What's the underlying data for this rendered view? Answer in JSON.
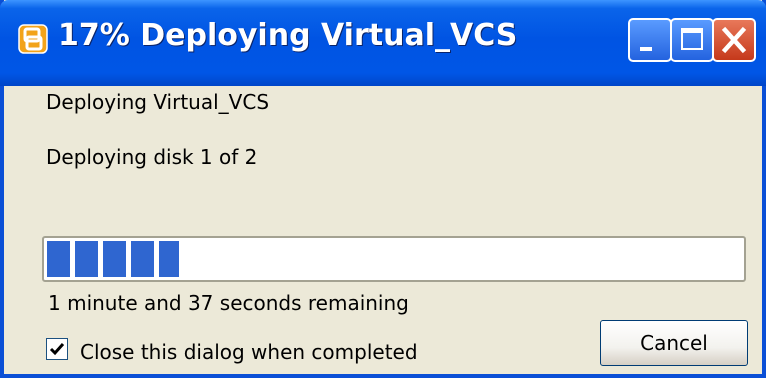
{
  "window": {
    "title": "17% Deploying Virtual_VCS",
    "icon": "vsphere-app-icon",
    "title_controls": [
      "minimize-icon",
      "maximize-icon",
      "close-icon"
    ]
  },
  "dialog": {
    "message_primary": "Deploying Virtual_VCS",
    "message_secondary": "Deploying disk 1 of 2",
    "progress_fraction": 0.19,
    "time_remaining": "1 minute and 37 seconds remaining",
    "close_when_completed": {
      "label": "Close this dialog when completed",
      "checked": true
    },
    "cancel_label": "Cancel"
  },
  "colors": {
    "titlebar": "#0054e3",
    "progress_block": "#2f66d0",
    "dialog_background": "#ece9d8",
    "close_button": "#c5391b"
  }
}
